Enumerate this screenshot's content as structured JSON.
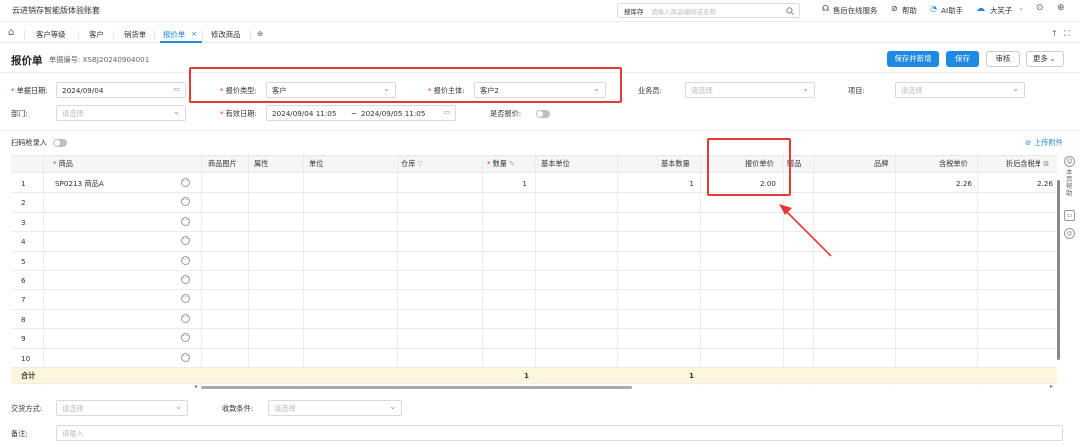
{
  "app": {
    "title": "云进销存智能版体验账套"
  },
  "topbar": {
    "search_label": "搜库存",
    "search_placeholder": "请输入商品编码或名称",
    "service": "售后在线服务",
    "help": "帮助",
    "ai": "AI助手",
    "user": "大芙子"
  },
  "tabs": [
    "客户等级",
    "客户",
    "销货单",
    "报价单",
    "修改商品"
  ],
  "tab_close": "×",
  "tab_add": "⊕",
  "page": {
    "title": "报价单",
    "doc_label": "单据编号:",
    "doc_no": "XSBJ20240904001"
  },
  "buttons": {
    "save_new": "保存并新增",
    "save": "保存",
    "audit": "审核",
    "more": "更多"
  },
  "form": {
    "date_label": "单据日期:",
    "date_value": "2024/09/04",
    "qtype_label": "报价类型:",
    "qtype_value": "客户",
    "subject_label": "报价主体:",
    "subject_value": "客户2",
    "salesman_label": "业务员:",
    "salesman_ph": "请选择",
    "project_label": "项目:",
    "project_ph": "请选择",
    "dept_label": "部门:",
    "dept_ph": "请选择",
    "valid_label": "有效日期:",
    "valid_from": "2024/09/04 11:05",
    "valid_sep": "~",
    "valid_to": "2024/09/05 11:05",
    "istax_label": "是否报价:"
  },
  "scan_label": "扫码枪录入",
  "upload_label": "上传附件",
  "table": {
    "headers": [
      "商品",
      "商品图片",
      "属性",
      "单位",
      "仓库",
      "数量",
      "基本单位",
      "基本数量",
      "报价单价",
      "赠品",
      "品牌",
      "含税单价",
      "折后含税单价"
    ],
    "rows": [
      {
        "n": "1",
        "product": "SP0213 商品A",
        "qty": "1",
        "base_qty": "1",
        "price": "2.00",
        "tax_price": "2.26",
        "disc_price": "2.26"
      },
      {
        "n": "2"
      },
      {
        "n": "3"
      },
      {
        "n": "4"
      },
      {
        "n": "5"
      },
      {
        "n": "6"
      },
      {
        "n": "7"
      },
      {
        "n": "8"
      },
      {
        "n": "9"
      },
      {
        "n": "10"
      }
    ],
    "sum_label": "合计",
    "sum_qty": "1",
    "sum_base_qty": "1"
  },
  "footer": {
    "pay_label": "交货方式:",
    "pay_ph": "请选择",
    "terms_label": "收款条件:",
    "terms_ph": "请选择",
    "note_label": "备注:",
    "note_ph": "请输入"
  },
  "side": {
    "help_text": "本页帮助"
  },
  "colors": {
    "accent": "#1e88e5",
    "highlight": "#e53935",
    "sum_bg": "#fdf5dc"
  }
}
